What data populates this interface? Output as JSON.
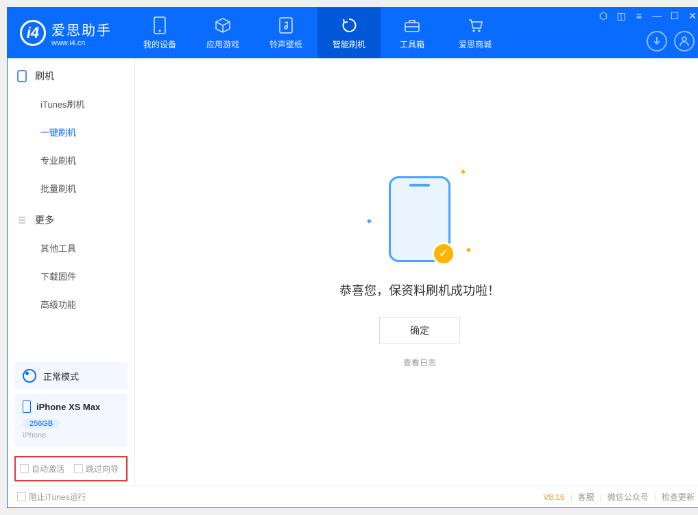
{
  "brand": {
    "name": "爱思助手",
    "url": "www.i4.cn"
  },
  "nav": {
    "items": [
      {
        "label": "我的设备"
      },
      {
        "label": "应用游戏"
      },
      {
        "label": "铃声壁纸"
      },
      {
        "label": "智能刷机"
      },
      {
        "label": "工具箱"
      },
      {
        "label": "爱思商城"
      }
    ]
  },
  "sidebar": {
    "section1": {
      "title": "刷机"
    },
    "items1": [
      {
        "label": "iTunes刷机"
      },
      {
        "label": "一键刷机"
      },
      {
        "label": "专业刷机"
      },
      {
        "label": "批量刷机"
      }
    ],
    "section2": {
      "title": "更多"
    },
    "items2": [
      {
        "label": "其他工具"
      },
      {
        "label": "下载固件"
      },
      {
        "label": "高级功能"
      }
    ]
  },
  "device": {
    "mode": "正常模式",
    "name": "iPhone XS Max",
    "storage": "256GB",
    "type": "iPhone"
  },
  "options": {
    "auto_activate": "自动激活",
    "skip_guide": "跳过向导"
  },
  "main": {
    "success_text": "恭喜您，保资料刷机成功啦！",
    "ok_button": "确定",
    "log_link": "查看日志"
  },
  "status": {
    "block_itunes": "阻止iTunes运行",
    "version": "V8.16",
    "service": "客服",
    "wechat": "微信公众号",
    "update": "检查更新"
  }
}
